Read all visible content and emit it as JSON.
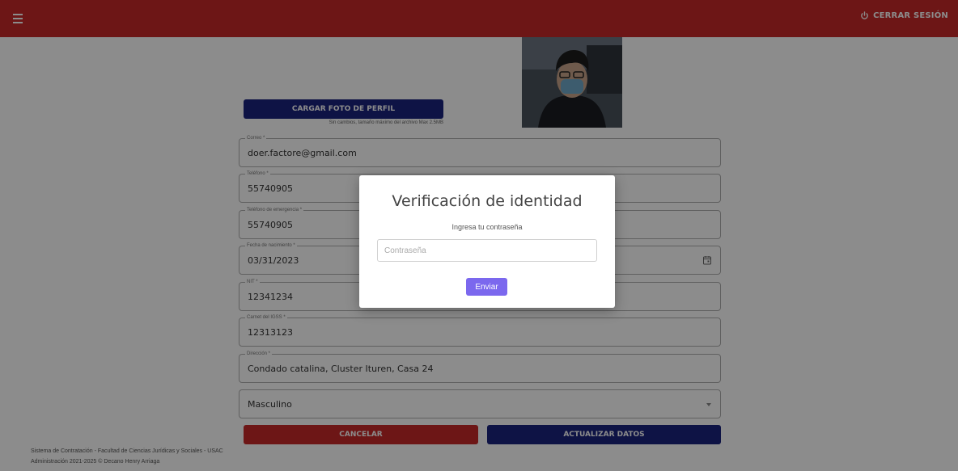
{
  "header": {
    "logout_label": "CERRAR SESIÓN"
  },
  "profile": {
    "upload_label": "CARGAR FOTO DE PERFIL",
    "upload_hint": "Sin cambios, tamaño máximo del archivo Max 2.5MB"
  },
  "form": {
    "email": {
      "label": "Correo *",
      "value": "doer.factore@gmail.com"
    },
    "phone": {
      "label": "Teléfono *",
      "value": "55740905"
    },
    "emergency_phone": {
      "label": "Teléfono de emergencia *",
      "value": "55740905"
    },
    "birth_date": {
      "label": "Fecha de nacimiento *",
      "value": "03/31/2023"
    },
    "nit": {
      "label": "NIT *",
      "value": "12341234"
    },
    "igss": {
      "label": "Carnet del IGSS *",
      "value": "12313123"
    },
    "address": {
      "label": "Dirección *",
      "value": "Condado catalina, Cluster Ituren, Casa 24"
    },
    "gender": {
      "value": "Masculino"
    }
  },
  "actions": {
    "cancel_label": "CANCELAR",
    "update_label": "ACTUALIZAR DATOS"
  },
  "footer": {
    "line1": "Sistema de Contratación - Facultad de Ciencias Jurídicas y Sociales - USAC",
    "line2": "Administración 2021-2025 © Decano Henry Arriaga"
  },
  "modal": {
    "title": "Verificación de identidad",
    "subtitle": "Ingresa tu contraseña",
    "password_placeholder": "Contraseña",
    "submit_label": "Enviar"
  },
  "colors": {
    "header_red": "#c62828",
    "navy": "#1a237e",
    "modal_button": "#7b68ee"
  }
}
